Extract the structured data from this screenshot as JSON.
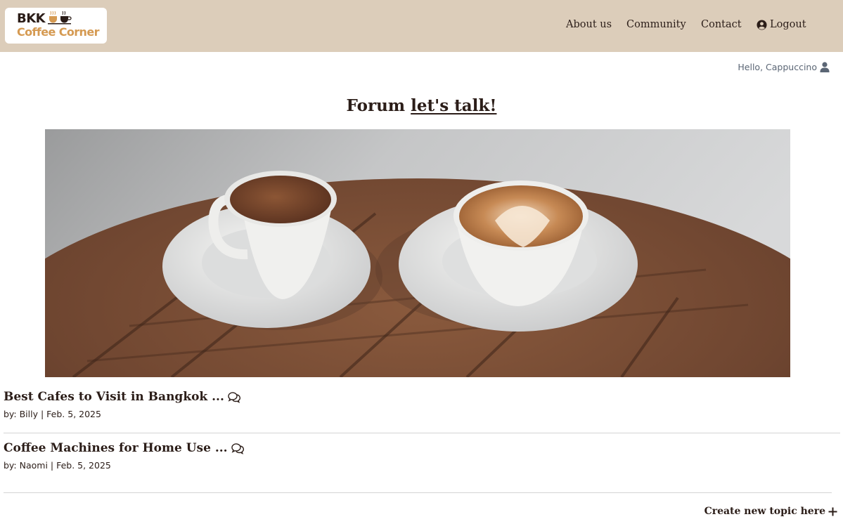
{
  "brand": {
    "logo_text_top": "BKK",
    "logo_text_bottom": "Coffee Corner",
    "colors": {
      "navbar_bg": "#dccdba",
      "logo_accent": "#d59a52",
      "text_dark": "#2b1d18"
    }
  },
  "nav": {
    "items": [
      {
        "label": "About us"
      },
      {
        "label": "Community"
      },
      {
        "label": "Contact"
      },
      {
        "label": "Logout",
        "icon": "user-circle-icon"
      }
    ]
  },
  "user": {
    "greeting": "Hello, Cappuccino",
    "icon": "user-icon"
  },
  "page": {
    "title_bold": "Forum",
    "title_link": "let's talk!"
  },
  "hero": {
    "subject": "two coffee cups on saucers on a round wooden table"
  },
  "topics": [
    {
      "title": "Best Cafes to Visit in Bangkok ...",
      "meta": "by: Billy | Feb. 5, 2025",
      "icon": "comments-icon"
    },
    {
      "title": "Coffee Machines for Home Use ...",
      "meta": "by: Naomi | Feb. 5, 2025",
      "icon": "comments-icon"
    }
  ],
  "actions": {
    "create_topic": "Create new topic here",
    "create_icon": "plus-icon"
  }
}
